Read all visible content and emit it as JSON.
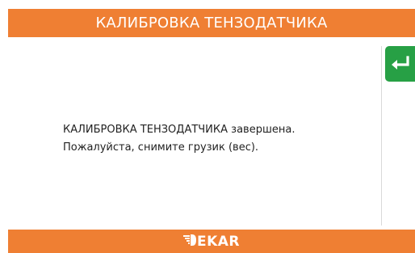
{
  "header": {
    "title": "КАЛИБРОВКА ТЕНЗОДАТЧИКА"
  },
  "actions": {
    "enter_icon": "enter-return-icon"
  },
  "message": {
    "line1": "КАЛИБРОВКА ТЕНЗОДАТЧИКА завершена.",
    "line2": "Пожалуйста, снимите грузик (вес)."
  },
  "footer": {
    "logo_text": "EKAR"
  },
  "colors": {
    "accent": "#ef7f33",
    "confirm": "#27a045"
  }
}
